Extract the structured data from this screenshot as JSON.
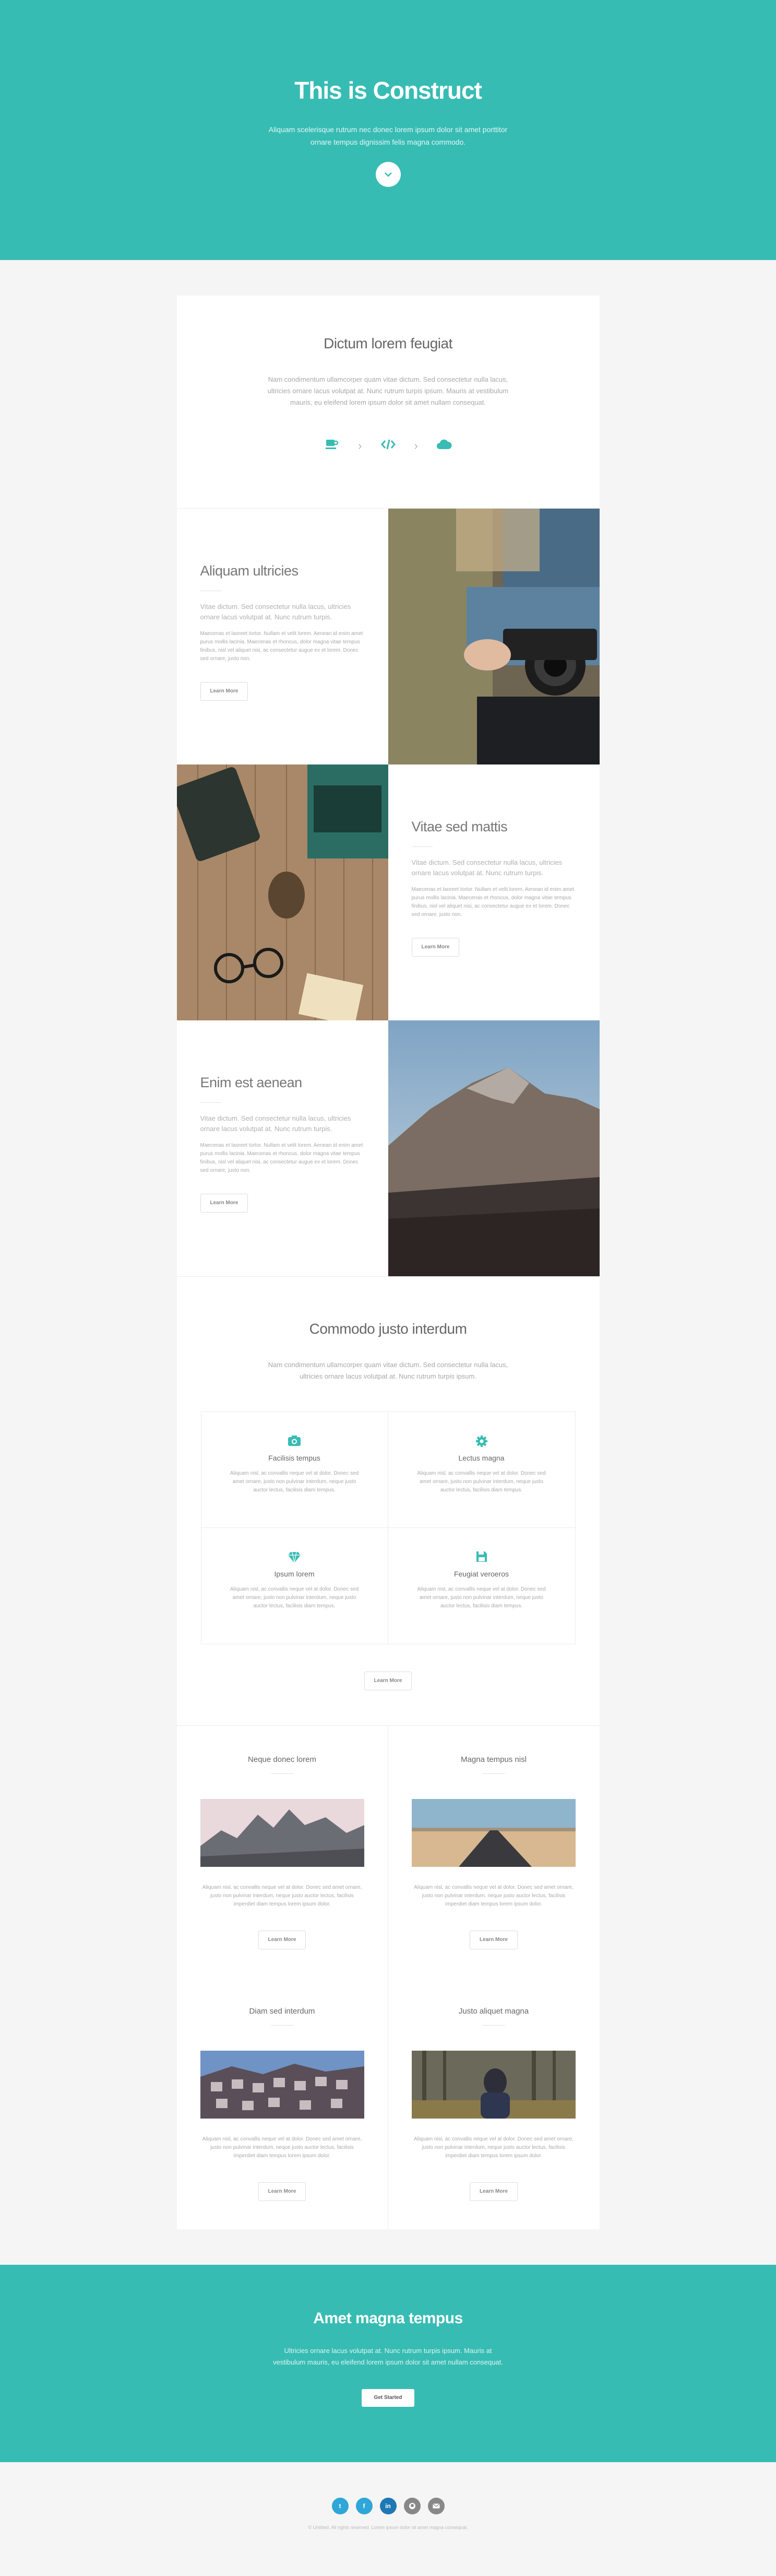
{
  "colors": {
    "accent": "#37bcb3",
    "background": "#f5f5f5",
    "card": "#ffffff"
  },
  "hero": {
    "title": "This is Construct",
    "text": "Aliquam scelerisque rutrum nec donec lorem ipsum dolor sit amet porttitor ornare tempus dignissim felis magna commodo.",
    "scroll_icon": "chevron-down-icon"
  },
  "intro": {
    "title": "Dictum lorem feugiat",
    "text": "Nam condimentum ullamcorper quam vitae dictum. Sed consectetur nulla lacus, ultricies ornare lacus volutpat at. Nunc rutrum turpis ipsum. Mauris at vestibulum mauris, eu eleifend lorem ipsum dolor sit amet nullam consequat.",
    "steps": [
      "coffee-icon",
      "code-icon",
      "cloud-icon"
    ]
  },
  "spotlights": [
    {
      "title": "Aliquam ultricies",
      "sub": "Vitae dictum. Sed consectetur nulla lacus, ultricies ornare lacus volutpat at. Nunc rutrum turpis.",
      "body": "Maecenas et laoreet tortor. Nullam et velit lorem. Aenean id enim amet purus mollis lacinia. Maecenas et rhoncus, dolor magna vitae tempus finibus, nisl vel aliquet nisi, ac consectetur augue ex et lorem. Donec sed ornare, justo non.",
      "button": "Learn More"
    },
    {
      "title": "Vitae sed mattis",
      "sub": "Vitae dictum. Sed consectetur nulla lacus, ultricies ornare lacus volutpat at. Nunc rutrum turpis.",
      "body": "Maecenas et laoreet tortor. Nullam et velit lorem. Aenean id enim amet purus mollis lacinia. Maecenas et rhoncus, dolor magna vitae tempus finibus, nisl vel aliquet nisi, ac consectetur augue ex et lorem. Donec sed ornare, justo non.",
      "button": "Learn More"
    },
    {
      "title": "Enim est aenean",
      "sub": "Vitae dictum. Sed consectetur nulla lacus, ultricies ornare lacus volutpat at. Nunc rutrum turpis.",
      "body": "Maecenas et laoreet tortor. Nullam et velit lorem. Aenean id enim amet purus mollis lacinia. Maecenas et rhoncus, dolor magna vitae tempus finibus, nisl vel aliquet nisi, ac consectetur augue ex et lorem. Donec sed ornare, justo non.",
      "button": "Learn More"
    }
  ],
  "features": {
    "title": "Commodo justo interdum",
    "text": "Nam condimentum ullamcorper quam vitae dictum. Sed consectetur nulla lacus, ultricies ornare lacus volutpat at. Nunc rutrum turpis ipsum.",
    "items": [
      {
        "icon": "camera-icon",
        "title": "Facilisis tempus",
        "text": "Aliquam nisl, ac convallis neque vel at dolor. Donec sed amet ornare, justo non pulvinar interdum, neque justo auctor lectus, facilisis diam tempus."
      },
      {
        "icon": "cog-icon",
        "title": "Lectus magna",
        "text": "Aliquam nisl, ac convallis neque vel at dolor. Donec sed amet ornare, justo non pulvinar interdum, neque justo auctor lectus, facilisis diam tempus."
      },
      {
        "icon": "diamond-icon",
        "title": "Ipsum lorem",
        "text": "Aliquam nisl, ac convallis neque vel at dolor. Donec sed amet ornare, justo non pulvinar interdum, neque justo auctor lectus, facilisis diam tempus."
      },
      {
        "icon": "save-icon",
        "title": "Feugiat veroeros",
        "text": "Aliquam nisl, ac convallis neque vel at dolor. Donec sed amet ornare, justo non pulvinar interdum, neque justo auctor lectus, facilisis diam tempus."
      }
    ],
    "button": "Learn More"
  },
  "posts": [
    {
      "title": "Neque donec lorem",
      "text": "Aliquam nisl, ac convallis neque vel at dolor. Donec sed amet ornare, justo non pulvinar interdum, neque justo auctor lectus, facilisis imperdiet diam tempus lorem ipsum dolor.",
      "button": "Learn More"
    },
    {
      "title": "Magna tempus nisl",
      "text": "Aliquam nisl, ac convallis neque vel at dolor. Donec sed amet ornare, justo non pulvinar interdum, neque justo auctor lectus, facilisis imperdiet diam tempus lorem ipsum dolor.",
      "button": "Learn More"
    },
    {
      "title": "Diam sed interdum",
      "text": "Aliquam nisl, ac convallis neque vel at dolor. Donec sed amet ornare, justo non pulvinar interdum, neque justo auctor lectus, facilisis imperdiet diam tempus lorem ipsum dolor.",
      "button": "Learn More"
    },
    {
      "title": "Justo aliquet magna",
      "text": "Aliquam nisl, ac convallis neque vel at dolor. Donec sed amet ornare, justo non pulvinar interdum, neque justo auctor lectus, facilisis imperdiet diam tempus lorem ipsum dolor.",
      "button": "Learn More"
    }
  ],
  "cta": {
    "title": "Amet magna tempus",
    "text": "Ultricies ornare lacus volutpat at. Nunc rutrum turpis ipsum. Mauris at vestibulum mauris, eu eleifend lorem ipsum dolor sit amet nullam consequat.",
    "button": "Get Started"
  },
  "footer": {
    "social": [
      "twitter-icon",
      "facebook-icon",
      "linkedin-icon",
      "github-icon",
      "email-icon"
    ],
    "copyright": "© Untitled. All rights reserved. Lorem ipsum dolor sit amet magna consequat."
  }
}
